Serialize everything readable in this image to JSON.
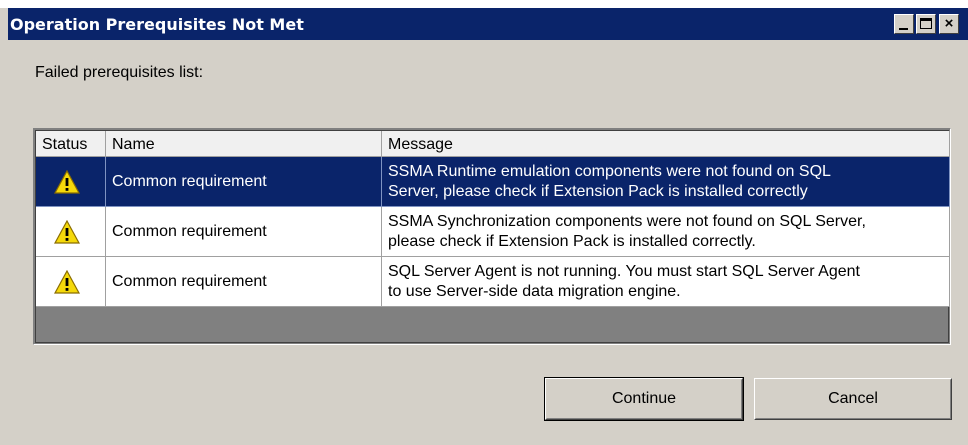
{
  "window": {
    "title": "Operation Prerequisites Not Met",
    "controls": {
      "minimize": "_",
      "maximize": "□",
      "close": "×"
    }
  },
  "main": {
    "list_label": "Failed prerequisites list:",
    "columns": {
      "status": "Status",
      "name": "Name",
      "message": "Message"
    },
    "rows": [
      {
        "status_icon": "warning-icon",
        "name": "Common requirement",
        "message_line1": "SSMA Runtime emulation components were not found on SQL",
        "message_line2": "Server, please check if Extension Pack is installed correctly",
        "selected": true
      },
      {
        "status_icon": "warning-icon",
        "name": "Common requirement",
        "message_line1": "SSMA Synchronization components were not found on SQL Server,",
        "message_line2": "please check if Extension Pack is installed correctly.",
        "selected": false
      },
      {
        "status_icon": "warning-icon",
        "name": "Common requirement",
        "message_line1": "SQL Server Agent is not running. You must start SQL Server Agent",
        "message_line2": "to use Server-side data migration engine.",
        "selected": false
      }
    ]
  },
  "buttons": {
    "continue": "Continue",
    "cancel": "Cancel"
  },
  "colors": {
    "titlebar": "#0a246a",
    "selection": "#0a246a",
    "dialog_face": "#d4d0c8",
    "warning": "#f5d90a"
  }
}
